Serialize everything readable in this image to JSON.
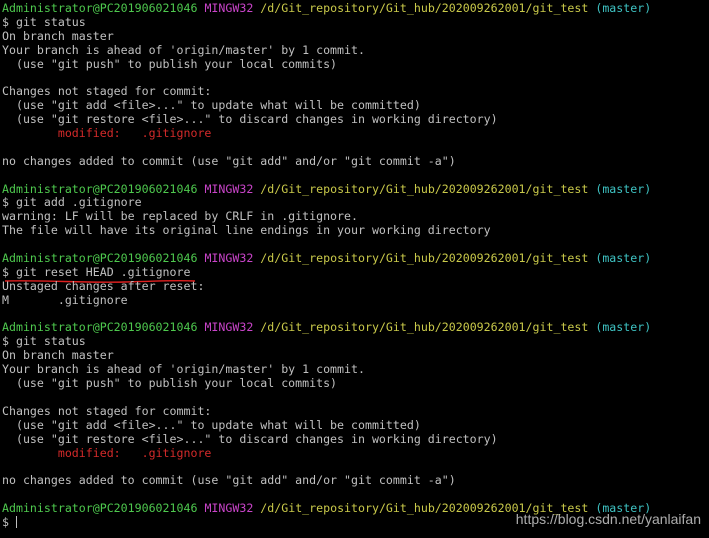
{
  "prompt": {
    "user": "Administrator@PC201906021046",
    "msystem": "MINGW32",
    "path": "/d/Git_repository/Git_hub/202009262001/git_test",
    "branch": "(master)",
    "symbol": "$"
  },
  "commands": {
    "c1": "git status",
    "c2": "git add .gitignore",
    "c3": "git reset HEAD .gitignore",
    "c4": "git status"
  },
  "status1": {
    "on_branch": "On branch master",
    "ahead": "Your branch is ahead of 'origin/master' by 1 commit.",
    "push_hint": "  (use \"git push\" to publish your local commits)",
    "changes_header": "Changes not staged for commit:",
    "add_hint": "  (use \"git add <file>...\" to update what will be committed)",
    "restore_hint": "  (use \"git restore <file>...\" to discard changes in working directory)",
    "modified_label": "        modified:",
    "modified_file": "   .gitignore",
    "no_changes": "no changes added to commit (use \"git add\" and/or \"git commit -a\")"
  },
  "add_output": {
    "warning": "warning: LF will be replaced by CRLF in .gitignore.",
    "note": "The file will have its original line endings in your working directory"
  },
  "reset_output": {
    "header": "Unstaged changes after reset:",
    "entry": "M       .gitignore"
  },
  "status2": {
    "on_branch": "On branch master",
    "ahead": "Your branch is ahead of 'origin/master' by 1 commit.",
    "push_hint": "  (use \"git push\" to publish your local commits)",
    "changes_header": "Changes not staged for commit:",
    "add_hint": "  (use \"git add <file>...\" to update what will be committed)",
    "restore_hint": "  (use \"git restore <file>...\" to discard changes in working directory)",
    "modified_label": "        modified:",
    "modified_file": "   .gitignore",
    "no_changes": "no changes added to commit (use \"git add\" and/or \"git commit -a\")"
  },
  "watermark": "https://blog.csdn.net/yanlaifan",
  "colors": {
    "background": "#000000",
    "text": "#c0c0c0",
    "user": "#4ec94e",
    "msystem": "#c944c9",
    "path": "#c9c94a",
    "branch": "#3ec2c2",
    "modified": "#d42a2a",
    "annotation": "#e02020"
  }
}
